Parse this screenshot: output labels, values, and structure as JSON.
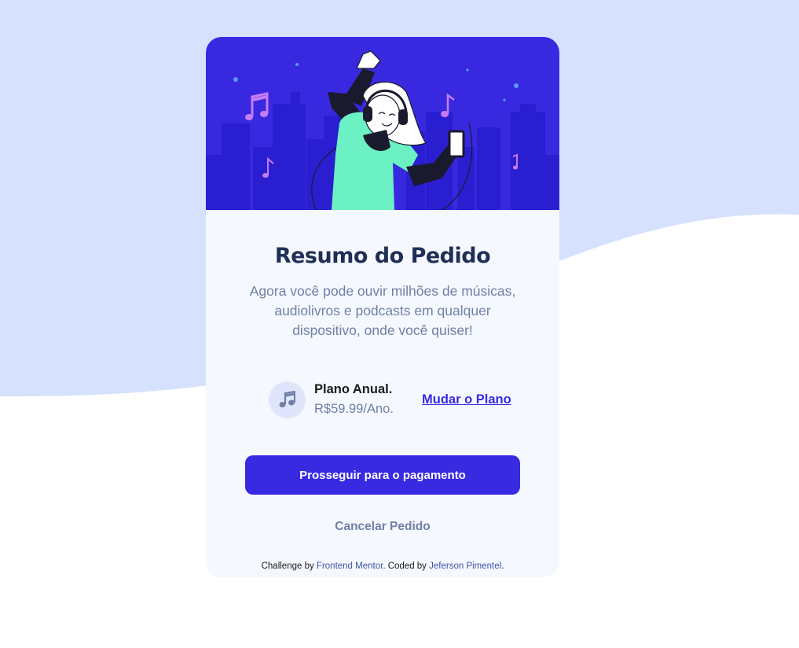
{
  "colors": {
    "page_top_background": "#d6e1fe",
    "page_bottom_background": "#ffffff",
    "card_background": "#f5f8ff",
    "hero_background": "#3829e0",
    "accent": "#382ae1",
    "heading": "#1f2f56",
    "muted_text": "#717fa6",
    "plan_icon_background": "#dfe6fb",
    "attribution_link": "#3e52a3"
  },
  "hero": {
    "illustration": "woman-dancing-with-headphones-illustration"
  },
  "card": {
    "title": "Resumo do Pedido",
    "description": "Agora você pode ouvir milhões de músicas, audiolivros e podcasts em qualquer dispositivo, onde você quiser!"
  },
  "plan": {
    "icon": "music-note-icon",
    "name": "Plano Anual.",
    "price": "R$59.99/Ano.",
    "change_label": "Mudar o Plano"
  },
  "actions": {
    "pay_label": "Prosseguir para o pagamento",
    "cancel_label": "Cancelar Pedido"
  },
  "attribution": {
    "prefix": "Challenge by ",
    "challenge_link": "Frontend Mentor",
    "middle": ". Coded by ",
    "author_link": "Jeferson Pimentel",
    "suffix": "."
  }
}
